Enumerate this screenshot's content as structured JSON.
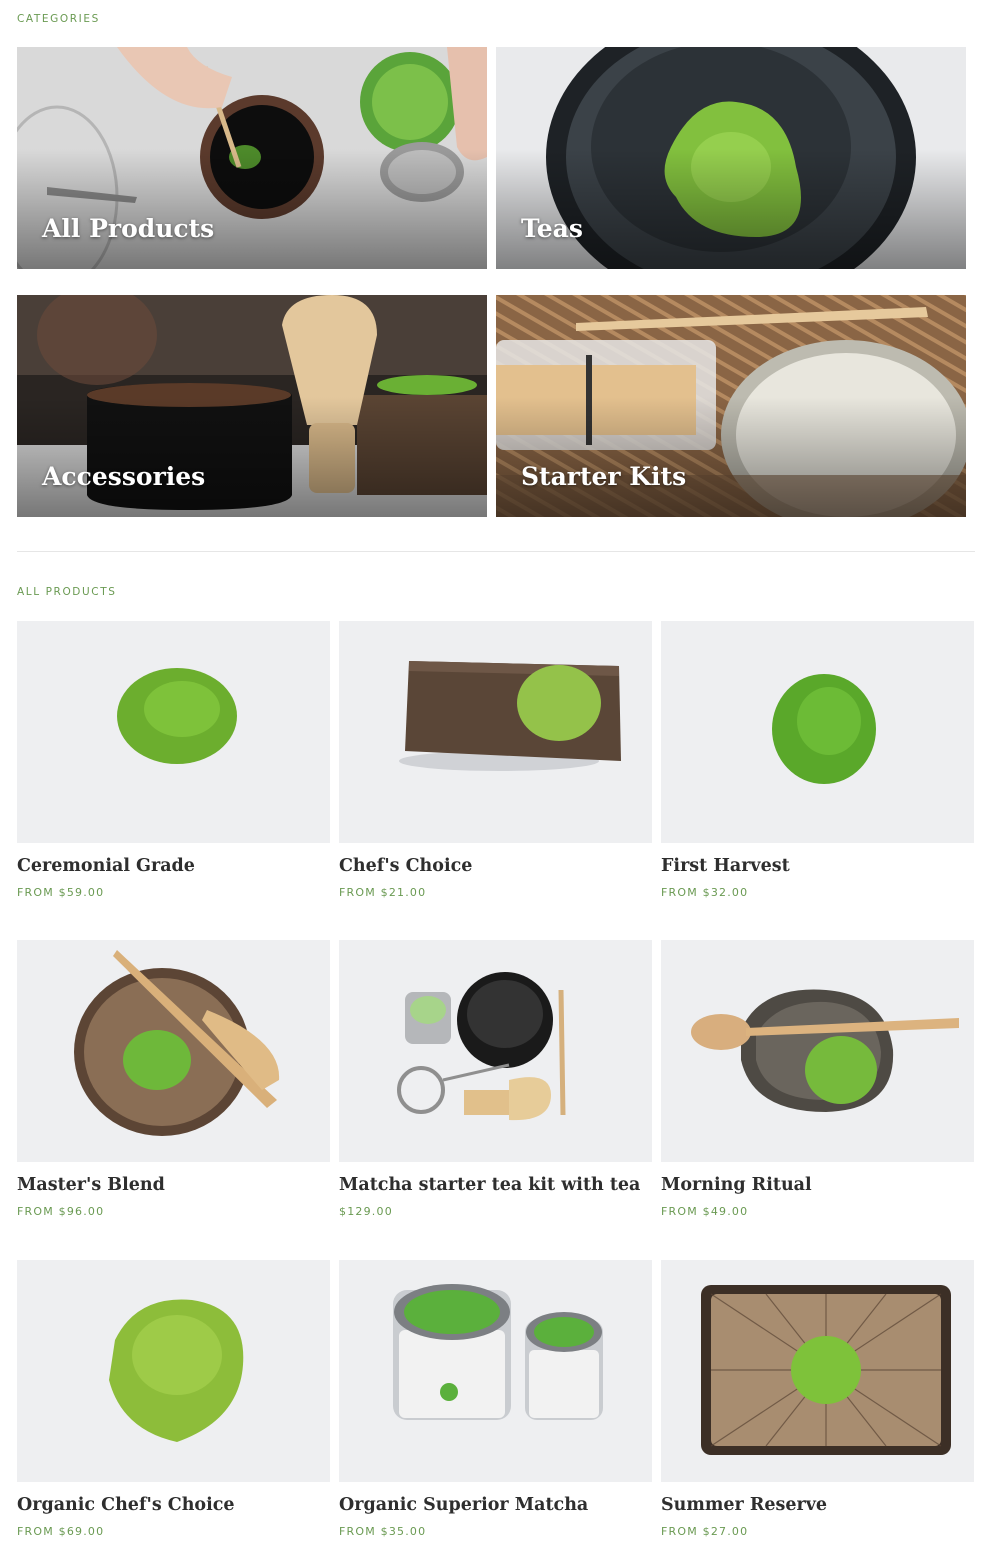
{
  "sections": {
    "categories_label": "CATEGORIES",
    "all_products_label": "ALL PRODUCTS"
  },
  "categories": [
    {
      "title": "All Products"
    },
    {
      "title": "Teas"
    },
    {
      "title": "Accessories"
    },
    {
      "title": "Starter Kits"
    }
  ],
  "products": [
    {
      "name": "Ceremonial Grade",
      "price": "FROM $59.00"
    },
    {
      "name": "Chef's Choice",
      "price": "FROM $21.00"
    },
    {
      "name": "First Harvest",
      "price": "FROM $32.00"
    },
    {
      "name": "Master's Blend",
      "price": "FROM $96.00"
    },
    {
      "name": "Matcha starter tea kit with tea",
      "price": "$129.00"
    },
    {
      "name": "Morning Ritual",
      "price": "FROM $49.00"
    },
    {
      "name": "Organic Chef's Choice",
      "price": "FROM $69.00"
    },
    {
      "name": "Organic Superior Matcha",
      "price": "FROM $35.00"
    },
    {
      "name": "Summer Reserve",
      "price": "FROM $27.00"
    }
  ],
  "colors": {
    "accent_green": "#6a9a52",
    "matcha": "#7cb93a",
    "text_dark": "#2e2e2e"
  }
}
